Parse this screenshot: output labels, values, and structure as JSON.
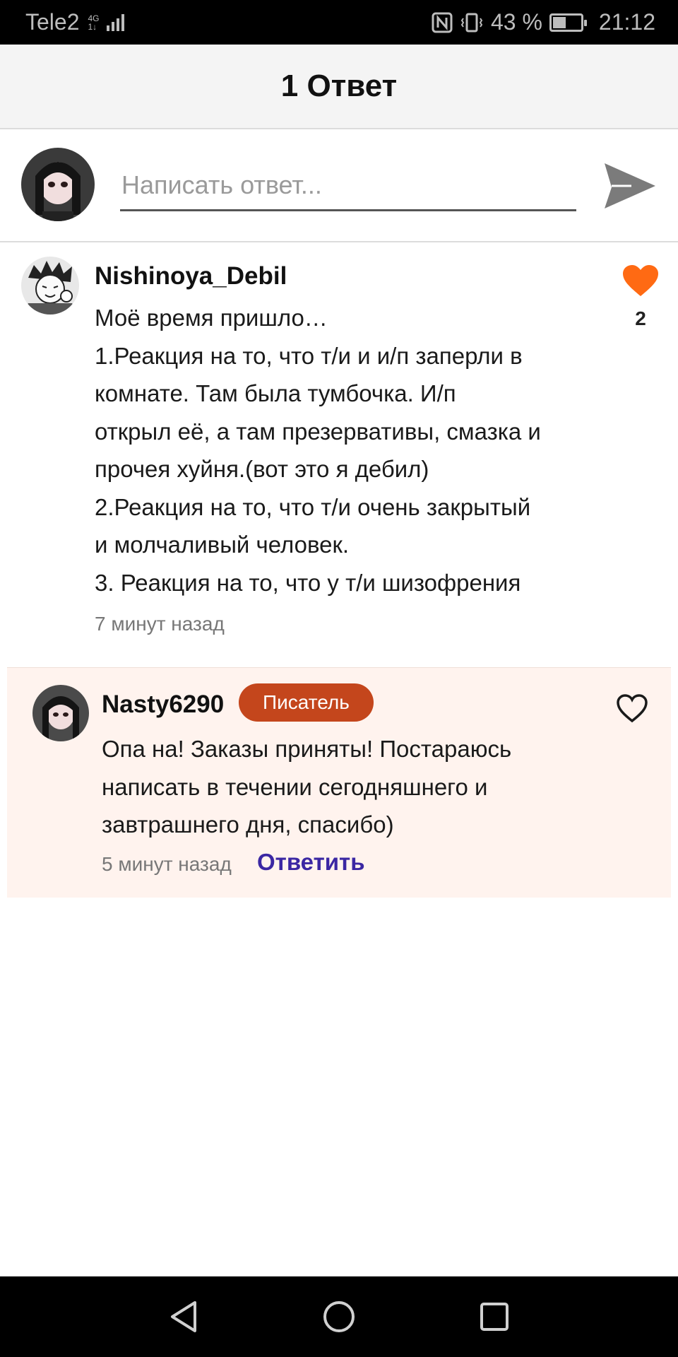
{
  "status_bar": {
    "carrier": "Tele2",
    "network_top": "4G",
    "network_bottom": "1↓",
    "battery_percent": "43 %",
    "battery_level": 0.43,
    "time": "21:12"
  },
  "header": {
    "title": "1 Ответ"
  },
  "composer": {
    "placeholder": "Написать ответ...",
    "value": "",
    "send_icon": "send-icon"
  },
  "comment": {
    "author": "Nishinoya_Debil",
    "lines": [
      "Моё время пришло…",
      "1.Реакция на то, что т/и и и/п заперли в",
      "комнате. Там была тумбочка. И/п",
      "открыл её, а там презервативы, смазка и",
      "прочея хуйня.(вот это я дебил)",
      "2.Реакция на то, что т/и очень закрытый",
      "и молчаливый человек.",
      "3. Реакция на то, что у т/и шизофрения"
    ],
    "time": "7 минут назад",
    "likes": "2",
    "liked": true,
    "like_color": "#ff6a13"
  },
  "reply": {
    "author": "Nasty6290",
    "badge": "Писатель",
    "badge_color": "#c4461c",
    "lines": [
      "Опа на! Заказы приняты! Постараюсь",
      "написать в течении сегодняшнего и",
      "завтрашнего дня, спасибо)"
    ],
    "time": "5 минут назад",
    "reply_label": "Ответить",
    "link_color": "#3b27a3"
  },
  "nav_bar": {
    "back_icon": "back-triangle-icon",
    "home_icon": "home-circle-icon",
    "recents_icon": "recents-square-icon"
  }
}
